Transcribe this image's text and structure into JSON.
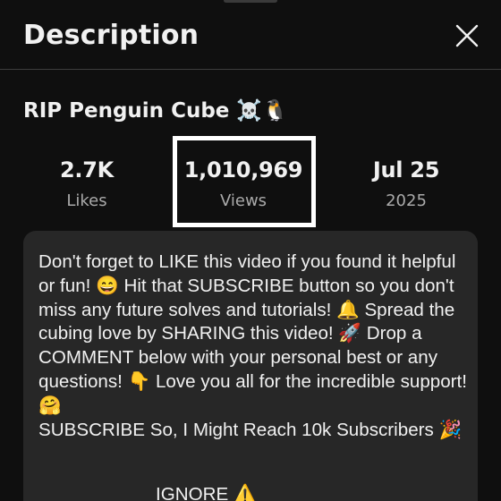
{
  "header": {
    "title": "Description"
  },
  "video": {
    "title": "RIP Penguin Cube ☠️🐧"
  },
  "stats": {
    "likes": {
      "value": "2.7K",
      "label": "Likes"
    },
    "views": {
      "value": "1,010,969",
      "label": "Views"
    },
    "date": {
      "value": "Jul 25",
      "label": "2025"
    }
  },
  "description": {
    "body": "Don't forget to LIKE this video if you found it helpful or fun! 😄 Hit that SUBSCRIBE button so you don't miss any future solves and tutorials! 🔔 Spread the cubing love by SHARING this video! 🚀 Drop a COMMENT below with your personal best or any questions! 👇 Love you all for the incredible support! 🤗\nSUBSCRIBE So, I Might Reach 10k Subscribers 🎉",
    "trailing": "IGNORE ⚠️"
  },
  "colors": {
    "background": "#0f0f0f",
    "card": "#272727",
    "text": "#f1f1f1",
    "secondary_text": "#aaaaaa",
    "highlight_border": "#ffffff"
  },
  "icons": {
    "close": "close-icon"
  }
}
